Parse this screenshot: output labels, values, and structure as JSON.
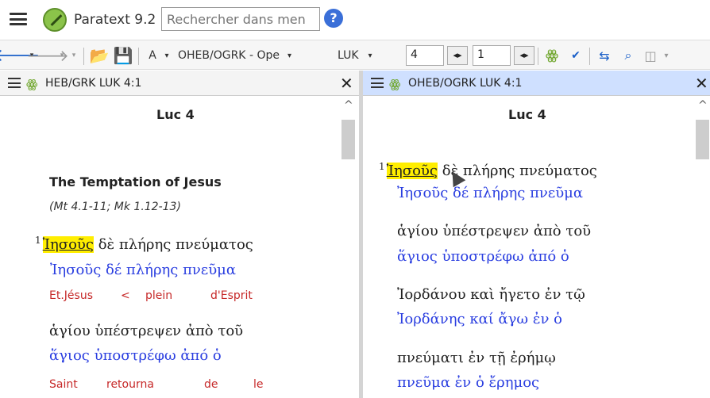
{
  "app": {
    "title": "Paratext 9.2",
    "search_placeholder": "Rechercher dans men"
  },
  "toolbar": {
    "font_btn": "A",
    "project": "OHEB/OGRK - Opе",
    "book": "LUK",
    "chapter": "4",
    "verse": "1"
  },
  "left_pane": {
    "title": "HEB/GRK LUK 4:1",
    "chapter": "Luc 4",
    "heading": "The Temptation of Jesus",
    "reference": "(Mt 4.1-11; Mk 1.12-13)",
    "verse_num": "1",
    "line1_greek_hl": "Ἰησοῦς",
    "line1_greek_rest": "δὲ  πλήρης  πνεύματος",
    "line1_lemma": "Ἰησοῦς  δέ  πλήρης  πνεῦμα",
    "line1_gloss": [
      "Et.Jésus",
      "<",
      "plein",
      "d'Esprit"
    ],
    "line2_greek": "ἁγίου  ὑπέστρεψεν  ἀπὸ  τοῦ",
    "line2_lemma": "ἅγιος  ὑποστρέφω  ἀπό  ὁ",
    "line2_gloss": [
      "Saint",
      "retourna",
      "de",
      "le"
    ]
  },
  "right_pane": {
    "title": "OHEB/OGRK LUK 4:1",
    "chapter": "Luc 4",
    "verse_num": "1",
    "line1_greek_hl": "Ἰησοῦς",
    "line1_greek_rest": "δὲ  πλήρης  πνεύματος",
    "line1_lemma": "Ἰησοῦς  δέ  πλήρης  πνεῦμα",
    "line2_greek": "ἁγίου  ὑπέστρεψεν  ἀπὸ  τοῦ",
    "line2_lemma": "ἅγιος  ὑποστρέφω  ἀπό  ὁ",
    "line3_greek": "Ἰορδάνου  καὶ  ἤγετο  ἐν  τῷ",
    "line3_lemma": "Ἰορδάνης  καί  ἄγω   ἐν  ὁ",
    "line4_greek": "πνεύματι  ἐν  τῇ  ἐρήμῳ",
    "line4_lemma": "πνεῦμα   ἐν  ὁ  ἔρημος"
  },
  "colors": {
    "lemma": "#2a3ee0",
    "gloss": "#c62828",
    "highlight": "#ffee00",
    "active_pane_header": "#cfe0ff"
  }
}
